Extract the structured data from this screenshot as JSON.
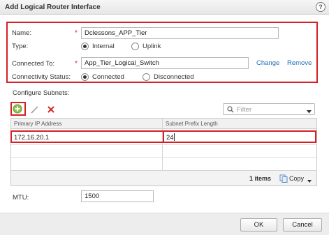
{
  "dialog": {
    "title": "Add Logical Router Interface",
    "help_glyph": "?"
  },
  "form": {
    "name_label": "Name:",
    "name_value": "Dclessons_APP_Tier",
    "type_label": "Type:",
    "type_options": [
      "Internal",
      "Uplink"
    ],
    "type_selected": "Internal",
    "connected_to_label": "Connected To:",
    "connected_to_value": "App_Tier_Logical_Switch",
    "change_link": "Change",
    "remove_link": "Remove",
    "connectivity_label": "Connectivity Status:",
    "connectivity_options": [
      "Connected",
      "Disconnected"
    ],
    "connectivity_selected": "Connected",
    "required_mark": "*"
  },
  "subnets": {
    "section_label": "Configure Subnets:",
    "filter_placeholder": "Filter",
    "columns": [
      "Primary IP Address",
      "Subnet Prefix Length"
    ],
    "rows": [
      {
        "ip": "172.16.20.1",
        "prefix": "24"
      }
    ],
    "item_count": "1 items",
    "copy_label": "Copy"
  },
  "mtu": {
    "label": "MTU:",
    "value": "1500"
  },
  "buttons": {
    "ok": "OK",
    "cancel": "Cancel"
  },
  "colors": {
    "highlight": "#d61f26",
    "link": "#1f6fb5"
  },
  "icons": [
    "help-icon",
    "add-icon",
    "edit-icon",
    "delete-icon",
    "search-icon",
    "dropdown-icon",
    "copy-icon"
  ]
}
